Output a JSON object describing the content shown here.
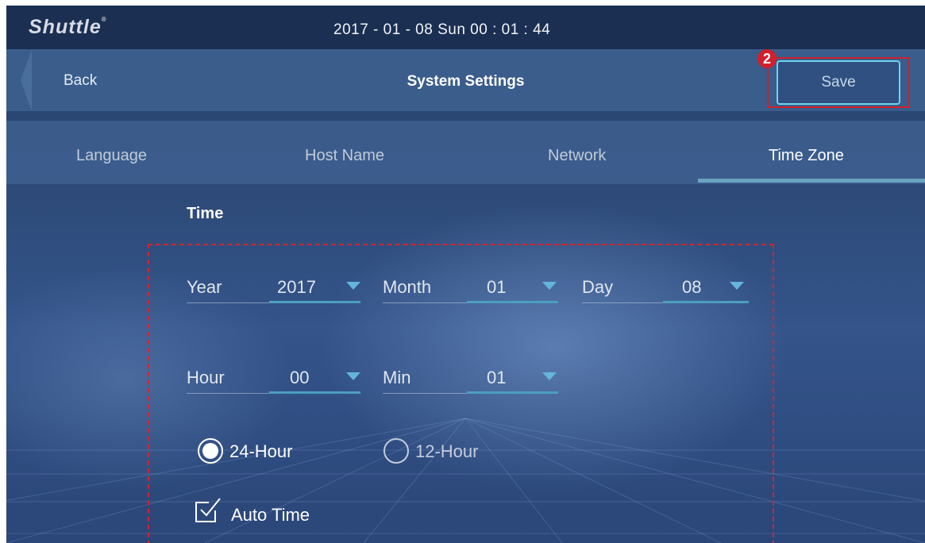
{
  "status_bar": {
    "brand": "Shuttle",
    "brand_mark": "®",
    "datetime": "2017 - 01 - 08  Sun  00 : 01 : 44"
  },
  "header": {
    "back_label": "Back",
    "title": "System Settings",
    "save_label": "Save",
    "step_badge": "2"
  },
  "tabs": [
    {
      "label": "Language",
      "active": false
    },
    {
      "label": "Host Name",
      "active": false
    },
    {
      "label": "Network",
      "active": false
    },
    {
      "label": "Time Zone",
      "active": true
    }
  ],
  "section": {
    "title": "Time"
  },
  "fields": {
    "year": {
      "label": "Year",
      "value": "2017"
    },
    "month": {
      "label": "Month",
      "value": "01"
    },
    "day": {
      "label": "Day",
      "value": "08"
    },
    "hour": {
      "label": "Hour",
      "value": "00"
    },
    "min": {
      "label": "Min",
      "value": "01"
    }
  },
  "format": {
    "options": [
      "24-Hour",
      "12-Hour"
    ],
    "selected": "24-Hour"
  },
  "auto_time": {
    "label": "Auto Time",
    "checked": true
  },
  "colors": {
    "accent": "#64b5dc",
    "annotation": "#d21f2b",
    "save_border": "#6ed4ea"
  }
}
